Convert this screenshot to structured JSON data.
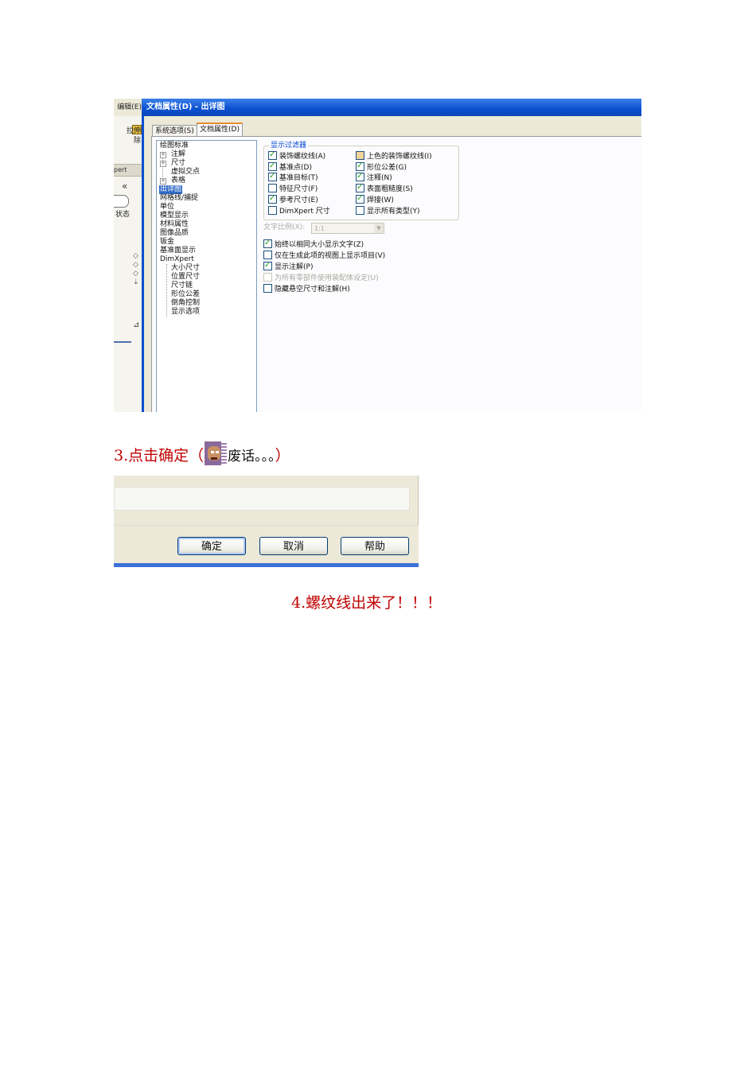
{
  "screenshot1": {
    "left_strip": {
      "menu": "编辑(E)",
      "button": "拉伸\n除",
      "tab": "pert",
      "chevron": "«",
      "state": "状态"
    },
    "dialog": {
      "title": "文档属性(D) - 出详图",
      "tabs": [
        "系统选项(S)",
        "文档属性(D)"
      ],
      "tree": [
        {
          "label": "绘图标准",
          "level": 0
        },
        {
          "label": "注解",
          "level": 1,
          "expander": "+"
        },
        {
          "label": "尺寸",
          "level": 1,
          "expander": "+"
        },
        {
          "label": "虚拟交点",
          "level": 2
        },
        {
          "label": "表格",
          "level": 1,
          "expander": "+"
        },
        {
          "label": "出详图",
          "level": 0,
          "selected": true
        },
        {
          "label": "网格线/捕捉",
          "level": 0
        },
        {
          "label": "单位",
          "level": 0
        },
        {
          "label": "模型显示",
          "level": 0
        },
        {
          "label": "材料属性",
          "level": 0
        },
        {
          "label": "图像品质",
          "level": 0
        },
        {
          "label": "钣金",
          "level": 0
        },
        {
          "label": "基准面显示",
          "level": 0
        },
        {
          "label": "DimXpert",
          "level": 0
        },
        {
          "label": "大小尺寸",
          "level": 2
        },
        {
          "label": "位置尺寸",
          "level": 2
        },
        {
          "label": "尺寸链",
          "level": 2
        },
        {
          "label": "形位公差",
          "level": 2
        },
        {
          "label": "倒角控制",
          "level": 2
        },
        {
          "label": "显示选项",
          "level": 2
        }
      ],
      "display_filter": {
        "title": "显示过滤器",
        "left_column": [
          {
            "label": "装饰螺纹线(A)",
            "checked": true
          },
          {
            "label": "基准点(D)",
            "checked": true
          },
          {
            "label": "基准目标(T)",
            "checked": true
          },
          {
            "label": "特征尺寸(F)",
            "checked": false
          },
          {
            "label": "参考尺寸(E)",
            "checked": true
          },
          {
            "label": "DimXpert 尺寸",
            "checked": false
          }
        ],
        "right_column": [
          {
            "label": "上色的装饰螺纹线(I)",
            "checked": false,
            "shaded": true
          },
          {
            "label": "形位公差(G)",
            "checked": true
          },
          {
            "label": "注释(N)",
            "checked": true
          },
          {
            "label": "表面粗糙度(S)",
            "checked": true
          },
          {
            "label": "焊接(W)",
            "checked": true
          },
          {
            "label": "显示所有类型(Y)",
            "checked": false
          }
        ]
      },
      "text_scale": {
        "label": "文字比例(X):",
        "value": "1:1"
      },
      "options": [
        {
          "label": "始终以相同大小显示文字(Z)",
          "checked": true,
          "disabled": false
        },
        {
          "label": "仅在生成此项的视图上显示项目(V)",
          "checked": false,
          "disabled": false
        },
        {
          "label": "显示注解(P)",
          "checked": true,
          "disabled": false
        },
        {
          "label": "为所有零部件使用装配体设定(U)",
          "checked": false,
          "disabled": true
        },
        {
          "label": "隐藏悬空尺寸和注解(H)",
          "checked": false,
          "disabled": false
        }
      ]
    }
  },
  "caption3": {
    "main": "3.点击确定（",
    "aside": "废话。。。",
    "close": "）"
  },
  "screenshot2": {
    "buttons": [
      "确定",
      "取消",
      "帮助"
    ]
  },
  "caption4": {
    "text": "4.螺纹线出来了！！！"
  }
}
